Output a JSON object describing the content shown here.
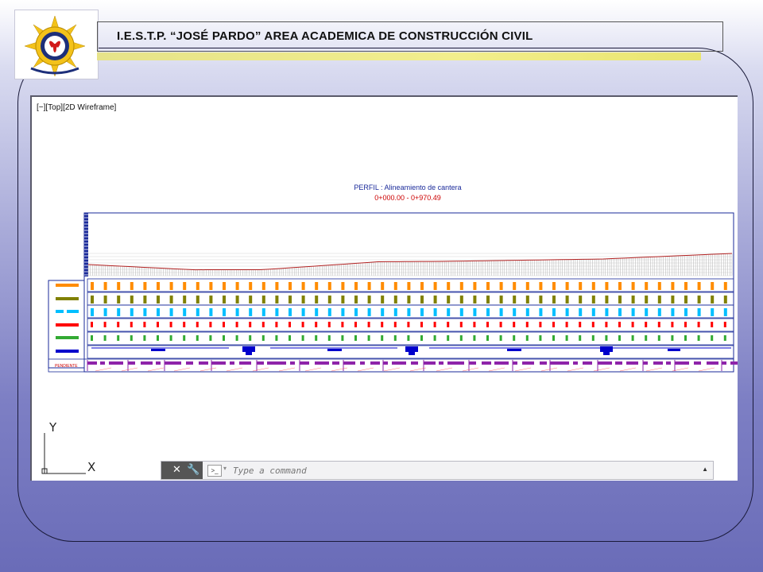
{
  "header": {
    "title": "I.E.S.T.P. “JOSÉ PARDO” AREA ACADEMICA DE CONSTRUCCIÓN CIVIL",
    "bar_color": "#ece87a"
  },
  "logo": {
    "icon": "institution-gear-emblem-icon",
    "colors": [
      "#f3c21a",
      "#1d2f7a",
      "#d11a1a"
    ]
  },
  "viewport": {
    "label": "[−][Top][2D Wireframe]",
    "drawing": {
      "title": "PERFIL : Alineamiento de cantera",
      "station_range": "0+000.00   -   0+970.49",
      "pendiente_label": "PENDIENTE",
      "row_colors": [
        "#ff8c00",
        "#808000",
        "#00bfff",
        "#ff0000",
        "#33aa33",
        "#0000cc"
      ],
      "profile_color": "#b22222",
      "frame_color": "#1a2a9a",
      "slope_color": "#8e24aa"
    },
    "ucs": {
      "x_label": "X",
      "y_label": "Y"
    }
  },
  "command_line": {
    "placeholder": "Type a command",
    "close_icon": "close-icon",
    "settings_icon": "wrench-icon",
    "prompt_icon": "command-prompt-icon"
  }
}
